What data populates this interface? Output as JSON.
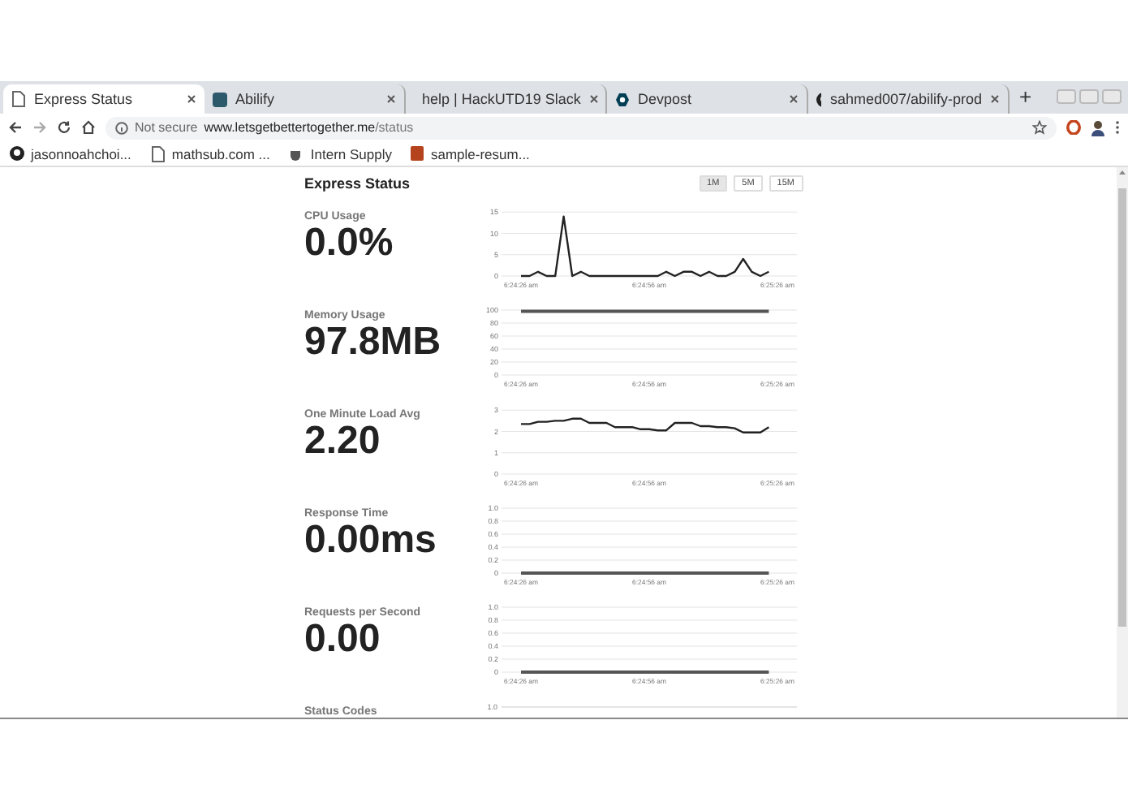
{
  "browser": {
    "tabs": [
      {
        "title": "Express Status",
        "selected": true
      },
      {
        "title": "Abilify",
        "selected": false
      },
      {
        "title": "help | HackUTD19 Slack",
        "selected": false
      },
      {
        "title": "Devpost",
        "selected": false
      },
      {
        "title": "sahmed007/abilify-prod",
        "selected": false
      }
    ],
    "new_tab": "+",
    "security": "Not secure",
    "url_host": "www.letsgetbettertogether.me",
    "url_path": "/status",
    "bookmarks": [
      {
        "title": "jasonnoahchoi..."
      },
      {
        "title": "mathsub.com ..."
      },
      {
        "title": "Intern Supply"
      },
      {
        "title": "sample-resum..."
      }
    ]
  },
  "page": {
    "title": "Express Status",
    "ranges": [
      {
        "label": "1M",
        "selected": true
      },
      {
        "label": "5M",
        "selected": false
      },
      {
        "label": "15M",
        "selected": false
      }
    ],
    "metrics": [
      {
        "label": "CPU Usage",
        "value": "0.0%",
        "chart_data": {
          "type": "line",
          "grid": true,
          "ylim": [
            0,
            16
          ],
          "yticks": [
            0,
            5,
            10,
            15
          ],
          "categories": [
            "6:24:26 am",
            null,
            null,
            null,
            null,
            null,
            null,
            null,
            null,
            null,
            null,
            null,
            null,
            null,
            null,
            "6:24:56 am",
            null,
            null,
            null,
            null,
            null,
            null,
            null,
            null,
            null,
            null,
            null,
            null,
            null,
            null,
            "6:25:26 am"
          ],
          "series": [
            {
              "color": "#222222",
              "values": [
                0,
                0,
                1,
                0,
                0,
                14,
                0,
                1,
                0,
                0,
                0,
                0,
                0,
                0,
                0,
                0,
                0,
                1,
                0,
                1,
                1,
                0,
                1,
                0,
                0,
                1,
                4,
                1,
                0,
                1,
                null
              ]
            }
          ]
        }
      },
      {
        "label": "Memory Usage",
        "value": "97.8MB",
        "chart_data": {
          "type": "line",
          "grid": true,
          "ylim": [
            0,
            105
          ],
          "yticks": [
            0,
            20,
            40,
            60,
            80,
            100
          ],
          "categories": [
            "6:24:26 am",
            null,
            null,
            null,
            null,
            null,
            null,
            null,
            null,
            null,
            null,
            null,
            null,
            null,
            null,
            "6:24:56 am",
            null,
            null,
            null,
            null,
            null,
            null,
            null,
            null,
            null,
            null,
            null,
            null,
            null,
            null,
            "6:25:26 am"
          ],
          "series": [
            {
              "color": "#555555",
              "values": [
                98,
                98,
                98,
                98,
                98,
                98,
                98,
                98,
                98,
                98,
                98,
                98,
                98,
                98,
                98,
                98,
                98,
                98,
                98,
                98,
                98,
                98,
                98,
                98,
                98,
                98,
                98,
                98,
                98,
                98,
                null
              ]
            }
          ]
        }
      },
      {
        "label": "One Minute Load Avg",
        "value": "2.20",
        "chart_data": {
          "type": "line",
          "grid": true,
          "ylim": [
            0,
            3.2
          ],
          "yticks": [
            0,
            1,
            2,
            3
          ],
          "categories": [
            "6:24:26 am",
            null,
            null,
            null,
            null,
            null,
            null,
            null,
            null,
            null,
            null,
            null,
            null,
            null,
            null,
            "6:24:56 am",
            null,
            null,
            null,
            null,
            null,
            null,
            null,
            null,
            null,
            null,
            null,
            null,
            null,
            null,
            "6:25:26 am"
          ],
          "series": [
            {
              "color": "#222222",
              "values": [
                2.35,
                2.35,
                2.45,
                2.45,
                2.5,
                2.5,
                2.6,
                2.6,
                2.4,
                2.4,
                2.4,
                2.2,
                2.2,
                2.2,
                2.1,
                2.1,
                2.05,
                2.05,
                2.4,
                2.4,
                2.4,
                2.25,
                2.25,
                2.2,
                2.2,
                2.15,
                1.95,
                1.95,
                1.95,
                2.2,
                null
              ]
            }
          ]
        }
      },
      {
        "label": "Response Time",
        "value": "0.00ms",
        "chart_data": {
          "type": "line",
          "grid": true,
          "ylim": [
            0,
            1.05
          ],
          "yticks": [
            0,
            {
              "value": 0.2,
              "label": "0.2"
            },
            {
              "value": 0.4,
              "label": "0.4"
            },
            {
              "value": 0.6,
              "label": "0.6"
            },
            {
              "value": 0.8,
              "label": "0.8"
            },
            {
              "value": 1,
              "label": "1.0"
            }
          ],
          "categories": [
            "6:24:26 am",
            null,
            null,
            null,
            null,
            null,
            null,
            null,
            null,
            null,
            null,
            null,
            null,
            null,
            null,
            "6:24:56 am",
            null,
            null,
            null,
            null,
            null,
            null,
            null,
            null,
            null,
            null,
            null,
            null,
            null,
            null,
            "6:25:26 am"
          ],
          "series": [
            {
              "color": "#555555",
              "values": [
                0,
                0,
                0,
                0,
                0,
                0,
                0,
                0,
                0,
                0,
                0,
                0,
                0,
                0,
                0,
                0,
                0,
                0,
                0,
                0,
                0,
                0,
                0,
                0,
                0,
                0,
                0,
                0,
                0,
                0,
                null
              ]
            }
          ]
        }
      },
      {
        "label": "Requests per Second",
        "value": "0.00",
        "chart_data": {
          "type": "line",
          "grid": true,
          "ylim": [
            0,
            1.05
          ],
          "yticks": [
            0,
            {
              "value": 0.2,
              "label": "0.2"
            },
            {
              "value": 0.4,
              "label": "0.4"
            },
            {
              "value": 0.6,
              "label": "0.6"
            },
            {
              "value": 0.8,
              "label": "0.8"
            },
            {
              "value": 1,
              "label": "1.0"
            }
          ],
          "categories": [
            "6:24:26 am",
            null,
            null,
            null,
            null,
            null,
            null,
            null,
            null,
            null,
            null,
            null,
            null,
            null,
            null,
            "6:24:56 am",
            null,
            null,
            null,
            null,
            null,
            null,
            null,
            null,
            null,
            null,
            null,
            null,
            null,
            null,
            "6:25:26 am"
          ],
          "series": [
            {
              "color": "#555555",
              "values": [
                0,
                0,
                0,
                0,
                0,
                0,
                0,
                0,
                0,
                0,
                0,
                0,
                0,
                0,
                0,
                0,
                0,
                0,
                0,
                0,
                0,
                0,
                0,
                0,
                0,
                0,
                0,
                0,
                0,
                0,
                null
              ]
            }
          ]
        }
      },
      {
        "label": "Status Codes",
        "top_tick": "1.0"
      }
    ]
  }
}
